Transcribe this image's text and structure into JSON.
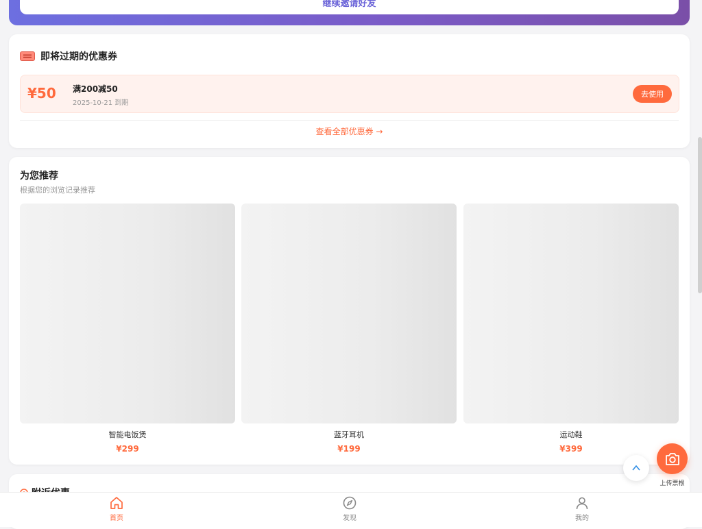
{
  "banner": {
    "button_label": "继续邀请好友"
  },
  "coupons": {
    "title": "即将过期的优惠券",
    "items": [
      {
        "amount": "¥50",
        "name": "满200减50",
        "expire": "2025-10-21 到期",
        "action": "去使用"
      }
    ],
    "view_all": "查看全部优惠券 →"
  },
  "recommend": {
    "title": "为您推荐",
    "subtitle": "根据您的浏览记录推荐",
    "products": [
      {
        "name": "智能电饭煲",
        "price": "¥299"
      },
      {
        "name": "蓝牙耳机",
        "price": "¥199"
      },
      {
        "name": "运动鞋",
        "price": "¥399"
      }
    ]
  },
  "nearby": {
    "title": "附近优惠"
  },
  "upload": {
    "label": "上传票根"
  },
  "nav": {
    "items": [
      {
        "label": "首页",
        "icon": "home-icon",
        "active": true
      },
      {
        "label": "发现",
        "icon": "compass-icon",
        "active": false
      },
      {
        "label": "我的",
        "icon": "user-icon",
        "active": false
      }
    ]
  },
  "colors": {
    "accent": "#ff6a3d",
    "banner_start": "#6d6fe0",
    "banner_end": "#7a4fa8"
  }
}
